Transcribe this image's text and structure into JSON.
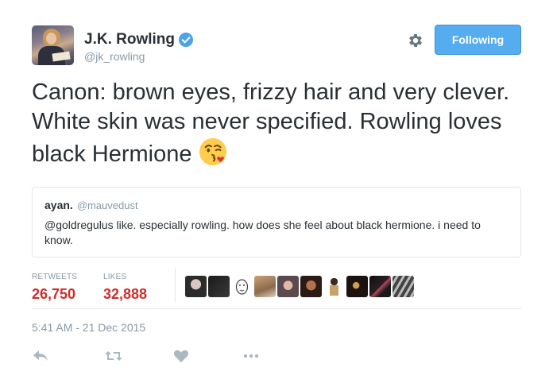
{
  "author": {
    "name": "J.K. Rowling",
    "handle": "@jk_rowling",
    "verified_icon": "verified-badge-icon"
  },
  "header": {
    "settings_icon": "gear-icon",
    "follow_label": "Following"
  },
  "tweet": {
    "text": "Canon: brown eyes, frizzy hair and very clever. White skin was never specified. Rowling loves black Hermione",
    "emoji": "face-blowing-kiss-emoji"
  },
  "quote": {
    "name": "ayan.",
    "handle": "@mauvedust",
    "text": "@goldregulus like. especially rowling. how does she feel about black hermione. i need to know."
  },
  "stats": {
    "retweets_label": "RETWEETS",
    "retweets_value": "26,750",
    "likes_label": "LIKES",
    "likes_value": "32,888"
  },
  "likers_count": 10,
  "timestamp": "5:41 AM - 21 Dec 2015",
  "actions": {
    "reply_icon": "reply-icon",
    "retweet_icon": "retweet-icon",
    "like_icon": "heart-icon",
    "more_icon": "more-icon"
  },
  "colors": {
    "accent": "#55acee",
    "stat_value": "#cf2c2c",
    "muted": "#8899a6",
    "text": "#292f33"
  }
}
